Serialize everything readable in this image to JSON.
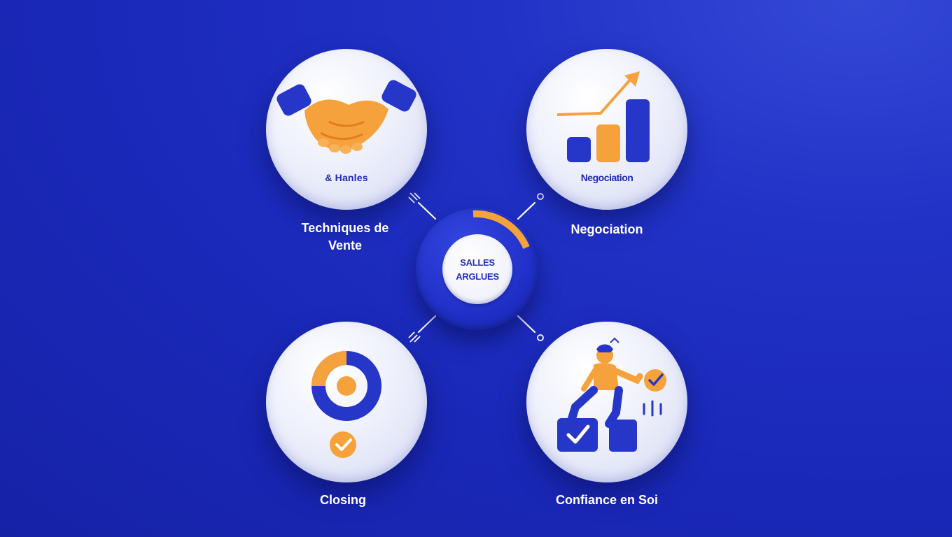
{
  "hub": {
    "label_line1": "SALLES",
    "label_line2": "ARGLUES",
    "ring_accent": "#f4a23a"
  },
  "nodes": [
    {
      "id": "techniques",
      "icon": "handshake-icon",
      "icon_text": "& Hanles",
      "caption_line1": "Techniques de",
      "caption_line2": "Vente"
    },
    {
      "id": "negociation",
      "icon": "growth-chart-icon",
      "icon_text": "Negociation",
      "caption_line1": "Negociation",
      "caption_line2": ""
    },
    {
      "id": "closing",
      "icon": "donut-target-icon",
      "icon_text": "",
      "caption_line1": "Closing",
      "caption_line2": ""
    },
    {
      "id": "confiance",
      "icon": "person-success-icon",
      "icon_text": "",
      "caption_line1": "Confiance en Soi",
      "caption_line2": ""
    }
  ],
  "colors": {
    "background": "#1a28b8",
    "accent_orange": "#f4a23a",
    "accent_blue": "#2233c4",
    "node_fill": "#eef0fb"
  }
}
